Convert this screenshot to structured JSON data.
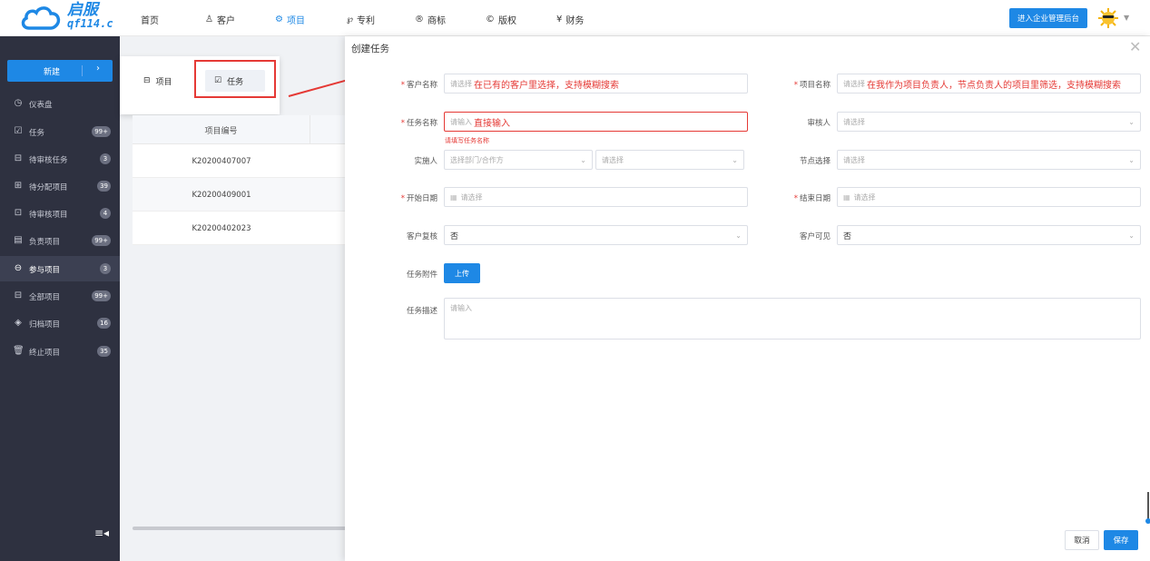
{
  "logo": {
    "brand": "启服",
    "url": "qf114.c"
  },
  "nav": [
    {
      "label": "首页",
      "icon": ""
    },
    {
      "label": "客户",
      "icon": "♙"
    },
    {
      "label": "项目",
      "icon": "⚙"
    },
    {
      "label": "专利",
      "icon": "℘"
    },
    {
      "label": "商标",
      "icon": "®"
    },
    {
      "label": "版权",
      "icon": "©"
    },
    {
      "label": "财务",
      "icon": "¥"
    }
  ],
  "nav_active": "项目",
  "header": {
    "enter_admin": "进入企业管理后台"
  },
  "sidebar": {
    "new_label": "新建",
    "items": [
      {
        "label": "仪表盘",
        "icon": "◷",
        "badge": ""
      },
      {
        "label": "任务",
        "icon": "☑",
        "badge": "99+"
      },
      {
        "label": "待审核任务",
        "icon": "⊟",
        "badge": "3"
      },
      {
        "label": "待分配项目",
        "icon": "⊞",
        "badge": "39"
      },
      {
        "label": "待审核项目",
        "icon": "⊡",
        "badge": "4"
      },
      {
        "label": "负责项目",
        "icon": "▤",
        "badge": "99+"
      },
      {
        "label": "参与项目",
        "icon": "⊖",
        "badge": "3"
      },
      {
        "label": "全部项目",
        "icon": "⊟",
        "badge": "99+"
      },
      {
        "label": "归档项目",
        "icon": "◈",
        "badge": "16"
      },
      {
        "label": "终止项目",
        "icon": "🗑",
        "badge": "35"
      }
    ],
    "active": "参与项目"
  },
  "popup": {
    "project": "项目",
    "task": "任务"
  },
  "table": {
    "header": "项目编号",
    "rows": [
      "K20200407007",
      "K20200409001",
      "K20200402023"
    ]
  },
  "dialog": {
    "title": "创建任务",
    "customer_label": "客户名称",
    "customer_placeholder": "请选择",
    "customer_note": "在已有的客户里选择，支持模糊搜索",
    "project_label": "项目名称",
    "project_placeholder": "请选择",
    "project_note": "在我作为项目负责人，节点负责人的项目里筛选，支持模糊搜索",
    "task_label": "任务名称",
    "task_placeholder": "请输入",
    "task_note": "直接输入",
    "task_error": "请填写任务名称",
    "reviewer_label": "审核人",
    "reviewer_placeholder": "请选择",
    "executor_label": "实施人",
    "executor_dept_placeholder": "选择部门/合作方",
    "executor_placeholder": "请选择",
    "node_label": "节点选择",
    "node_placeholder": "请选择",
    "start_label": "开始日期",
    "start_placeholder": "请选择",
    "end_label": "结束日期",
    "end_placeholder": "请选择",
    "review_label": "客户复核",
    "review_value": "否",
    "visible_label": "客户可见",
    "visible_value": "否",
    "attach_label": "任务附件",
    "upload_label": "上传",
    "desc_label": "任务描述",
    "desc_placeholder": "请输入",
    "cancel": "取消",
    "save": "保存"
  },
  "colors": {
    "primary": "#1e88e5",
    "sidebar_bg": "#2e3140",
    "annotation_red": "#e53935"
  }
}
